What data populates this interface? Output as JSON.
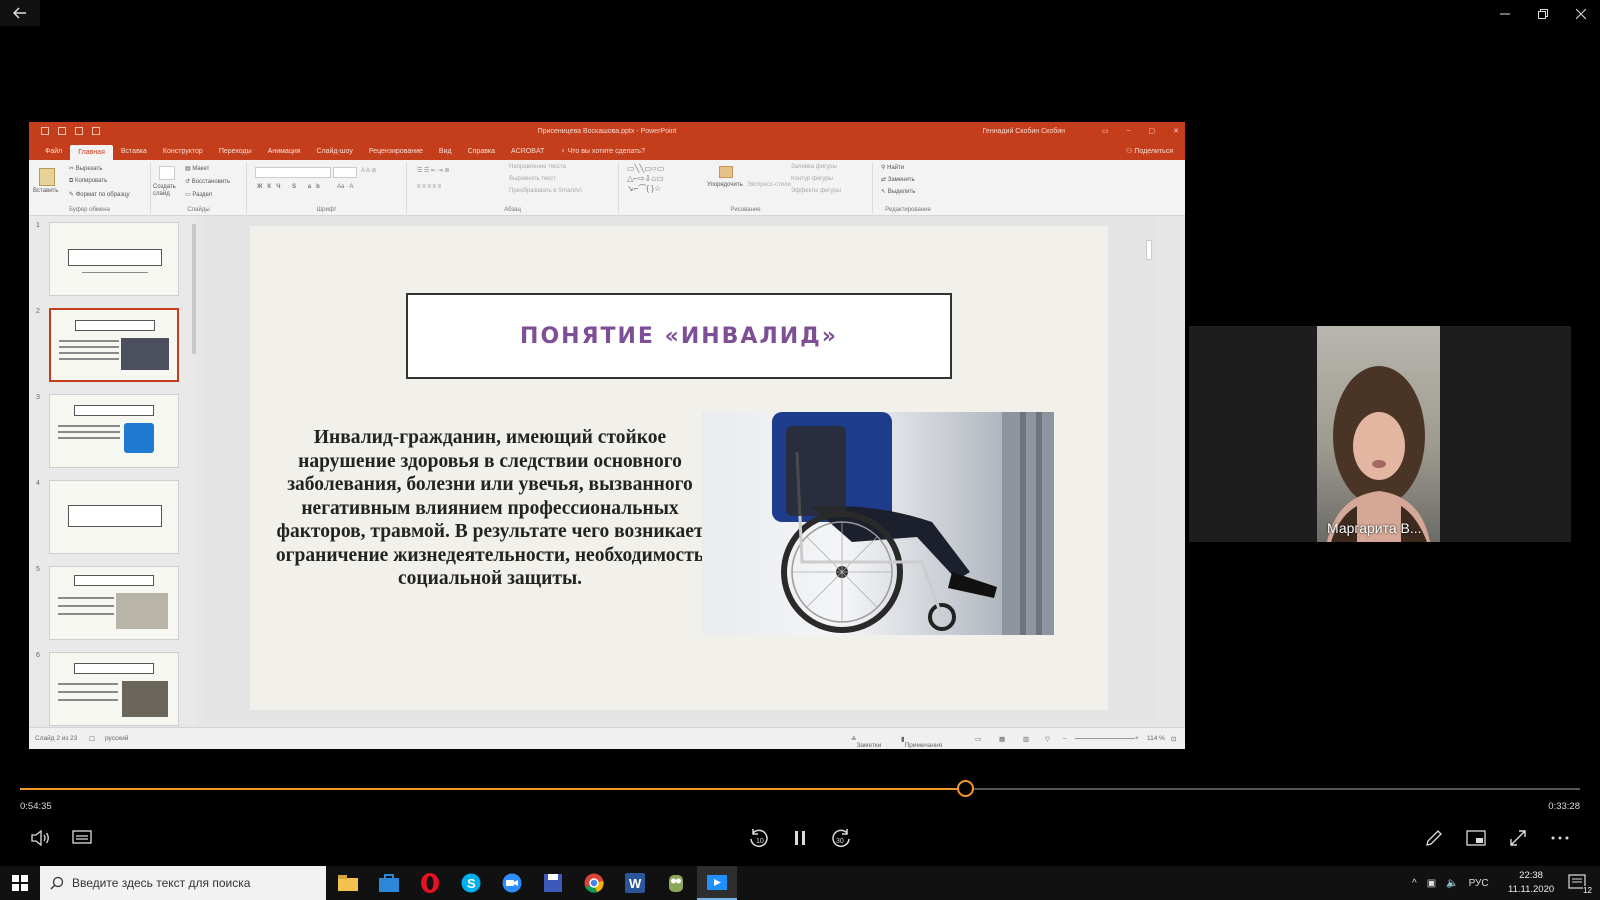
{
  "player": {
    "elapsed": "0:54:35",
    "remaining": "0:33:28",
    "progress_fraction": 0.606
  },
  "ppt": {
    "window_title": "Присеницева Воскашова.pptx  -  PowerPoint",
    "user_name": "Геннадий Скобин Скобин",
    "tabs": [
      "Файл",
      "Главная",
      "Вставка",
      "Конструктор",
      "Переходы",
      "Анимация",
      "Слайд-шоу",
      "Рецензирование",
      "Вид",
      "Справка",
      "ACROBAT"
    ],
    "active_tab": "Главная",
    "tell_me": "Что вы хотите сделать?",
    "share": "Поделиться",
    "ribbon": {
      "paste": "Вставить",
      "cut": "Вырезать",
      "copy": "Копировать",
      "format_painter": "Формат по образцу",
      "clipboard_group": "Буфер обмена",
      "layout": "Макет",
      "reset": "Восстановить",
      "section": "Раздел",
      "new_slide": "Создать слайд",
      "slides_group": "Слайды",
      "font_group": "Шрифт",
      "text_direction": "Направление текста",
      "align_text": "Выровнять текст",
      "convert_smartart": "Преобразовать в SmartArt",
      "paragraph_group": "Абзац",
      "arrange": "Упорядочить",
      "quick_styles": "Экспресс-стили",
      "shape_fill": "Заливка фигуры",
      "shape_outline": "Контур фигуры",
      "shape_effects": "Эффекты фигуры",
      "drawing_group": "Рисование",
      "find": "Найти",
      "replace": "Заменить",
      "select": "Выделить",
      "editing_group": "Редактирование"
    },
    "thumb_numbers": [
      "1",
      "2",
      "3",
      "4",
      "5",
      "6"
    ],
    "slide": {
      "title": "ПОНЯТИЕ «ИНВАЛИД»",
      "body": "Инвалид-гражданин, имеющий стойкое нарушение здоровья в следствии основного заболевания, болезни или увечья, вызванного негативным влиянием профессиональных факторов, травмой. В результате чего возникает ограничение жизнедеятельности, необходимость социальной защиты."
    },
    "status": {
      "slide_counter": "Слайд 2 из 23",
      "language": "русский",
      "notes": "Заметки",
      "comments": "Примечания",
      "zoom": "114 %"
    }
  },
  "participant": {
    "name": "Маргарита В..."
  },
  "taskbar": {
    "search_placeholder": "Введите здесь текст для поиска",
    "language": "РУС",
    "time": "22:38",
    "date": "11.11.2020",
    "notification_count": "12"
  },
  "colors": {
    "ppt_accent": "#c43e1c",
    "seek_accent": "#f1972e",
    "slide_title": "#7e4f96"
  }
}
